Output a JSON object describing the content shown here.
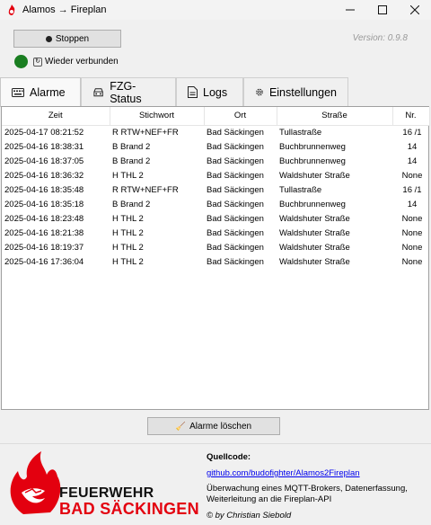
{
  "window": {
    "title": "Alamos → Fireplan",
    "minimize": "—",
    "maximize": "☐",
    "close": "✕"
  },
  "toolbar": {
    "stop_label": "Stoppen",
    "version": "Version: 0.9.8"
  },
  "status": {
    "text": "Wieder verbunden",
    "color": "#1a7e21"
  },
  "tabs": [
    {
      "label": "Alarme",
      "icon": "keyboard-icon"
    },
    {
      "label": "FZG-Status",
      "icon": "vehicle-icon"
    },
    {
      "label": "Logs",
      "icon": "document-icon"
    },
    {
      "label": "Einstellungen",
      "icon": "gear-icon"
    }
  ],
  "table": {
    "columns": [
      "Zeit",
      "Stichwort",
      "Ort",
      "Straße",
      "Nr."
    ],
    "rows": [
      [
        "2025-04-17 08:21:52",
        "R RTW+NEF+FR",
        "Bad Säckingen",
        "Tullastraße",
        "16 /1"
      ],
      [
        "2025-04-16 18:38:31",
        "B Brand 2",
        "Bad Säckingen",
        "Buchbrunnenweg",
        "14"
      ],
      [
        "2025-04-16 18:37:05",
        "B Brand 2",
        "Bad Säckingen",
        "Buchbrunnenweg",
        "14"
      ],
      [
        "2025-04-16 18:36:32",
        "H THL 2",
        "Bad Säckingen",
        "Waldshuter Straße",
        "None"
      ],
      [
        "2025-04-16 18:35:48",
        "R RTW+NEF+FR",
        "Bad Säckingen",
        "Tullastraße",
        "16 /1"
      ],
      [
        "2025-04-16 18:35:18",
        "B Brand 2",
        "Bad Säckingen",
        "Buchbrunnenweg",
        "14"
      ],
      [
        "2025-04-16 18:23:48",
        "H THL 2",
        "Bad Säckingen",
        "Waldshuter Straße",
        "None"
      ],
      [
        "2025-04-16 18:21:38",
        "H THL 2",
        "Bad Säckingen",
        "Waldshuter Straße",
        "None"
      ],
      [
        "2025-04-16 18:19:37",
        "H THL 2",
        "Bad Säckingen",
        "Waldshuter Straße",
        "None"
      ],
      [
        "2025-04-16 17:36:04",
        "H THL 2",
        "Bad Säckingen",
        "Waldshuter Straße",
        "None"
      ]
    ]
  },
  "actions": {
    "clear_label": "Alarme löschen"
  },
  "footer": {
    "logo_line1": "FEUERWEHR",
    "logo_line2": "BAD SÄCKINGEN",
    "source_label": "Quellcode:",
    "link": "github.com/budofighter/Alamos2Fireplan",
    "description": "Überwachung eines MQTT-Brokers, Datenerfassung, Weiterleitung an die Fireplan-API",
    "author": "© by Christian Siebold"
  },
  "colors": {
    "brand_red": "#e3000f",
    "link": "#0000ee"
  }
}
